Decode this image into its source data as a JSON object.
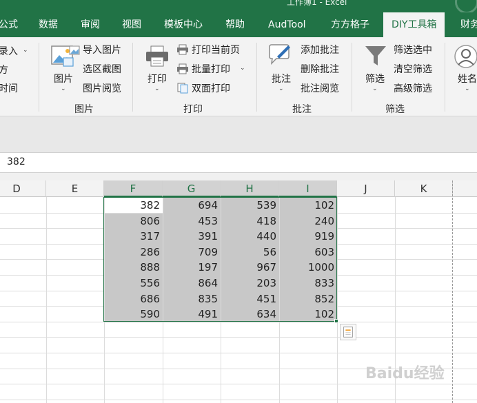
{
  "title": {
    "text": "工作簿1 - Excel"
  },
  "tabs": [
    "公式",
    "数据",
    "审阅",
    "视图",
    "模板中心",
    "帮助",
    "AudTool",
    "方方格子",
    "DIY工具箱",
    "财务"
  ],
  "ribbon": {
    "left_partial": [
      "录入",
      "方",
      "时间"
    ],
    "pictures": {
      "big": "图片",
      "items": [
        "导入图片",
        "选区截图",
        "图片阅览"
      ],
      "label": "图片"
    },
    "print": {
      "big": "打印",
      "items": [
        "打印当前页",
        "批量打印",
        "双面打印"
      ],
      "label": "打印"
    },
    "comments": {
      "big": "批注",
      "items": [
        "添加批注",
        "删除批注",
        "批注阅览"
      ],
      "label": "批注"
    },
    "filter": {
      "big": "筛选",
      "items": [
        "筛选选中",
        "清空筛选",
        "高级筛选"
      ],
      "label": "筛选"
    },
    "name": {
      "big": "姓名"
    }
  },
  "formula_bar": {
    "value": "382"
  },
  "columns": [
    "D",
    "E",
    "F",
    "G",
    "H",
    "I",
    "J",
    "K"
  ],
  "rows": [
    [
      382,
      694,
      539,
      102
    ],
    [
      806,
      453,
      418,
      240
    ],
    [
      317,
      391,
      440,
      919
    ],
    [
      286,
      709,
      56,
      603
    ],
    [
      888,
      197,
      967,
      1000
    ],
    [
      556,
      864,
      203,
      833
    ],
    [
      686,
      835,
      451,
      852
    ],
    [
      590,
      491,
      634,
      102
    ]
  ],
  "colors": {
    "brand": "#217346",
    "selection_shade": "#c8c8c8"
  },
  "watermark": "Baidu经验"
}
